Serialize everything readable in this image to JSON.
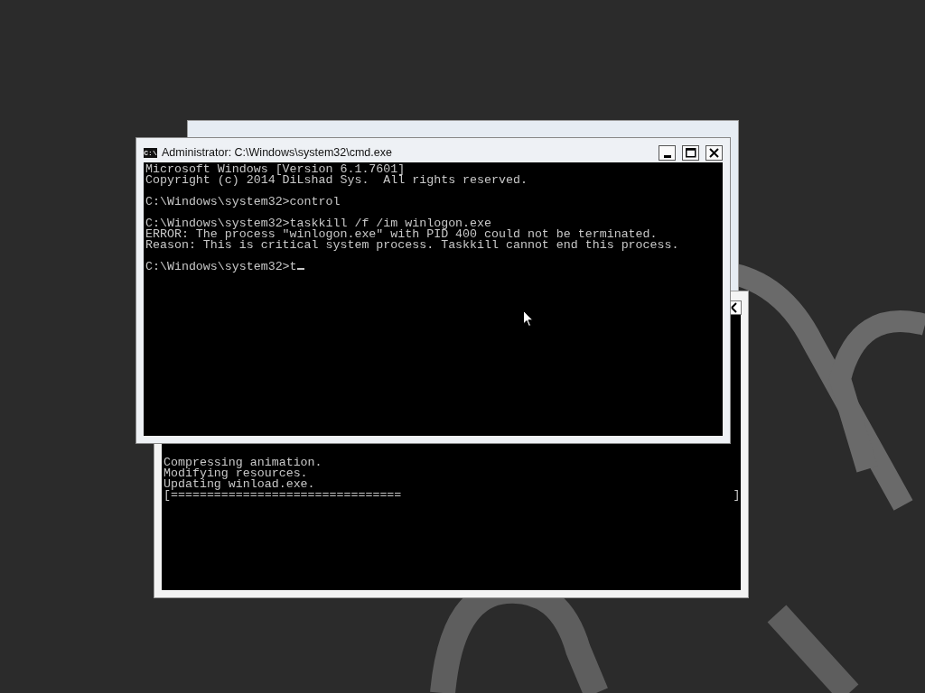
{
  "back_window": {
    "console_lines": [
      "Compressing animation.",
      "Modifying resources.",
      "Updating winload.exe.",
      "[================================                                              ]"
    ]
  },
  "cmd_window": {
    "title": "Administrator: C:\\Windows\\system32\\cmd.exe",
    "icon_text": "C:\\",
    "controls": [
      {
        "kind": "minimize"
      },
      {
        "kind": "maximize"
      },
      {
        "kind": "close"
      }
    ],
    "console_blocks": [
      [
        "Microsoft Windows [Version 6.1.7601]",
        "Copyright (c) 2014 DiLshad Sys.  All rights reserved."
      ],
      [
        "C:\\Windows\\system32>control"
      ],
      [
        "C:\\Windows\\system32>taskkill /f /im winlogon.exe",
        "ERROR: The process \"winlogon.exe\" with PID 400 could not be terminated.",
        "Reason: This is critical system process. Taskkill cannot end this process."
      ],
      [
        "C:\\Windows\\system32>t"
      ]
    ]
  }
}
